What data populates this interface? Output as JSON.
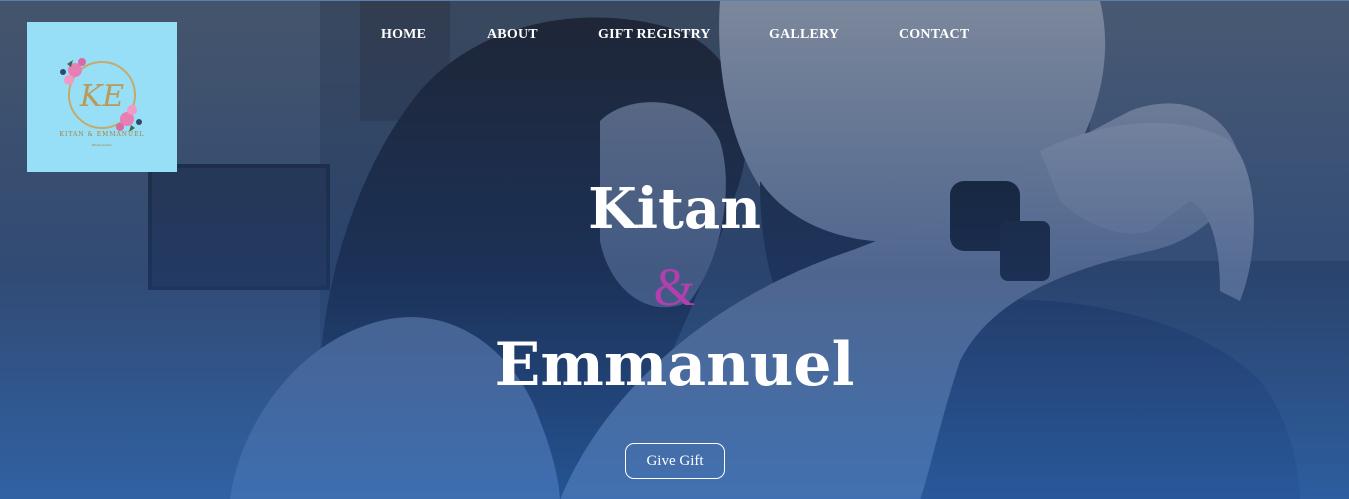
{
  "logo": {
    "monogram": "KE",
    "name": "KITAN & EMMANUEL",
    "subtitle": "#Kekeimbido"
  },
  "nav": {
    "items": [
      {
        "label": "HOME"
      },
      {
        "label": "ABOUT"
      },
      {
        "label": "GIFT REGISTRY"
      },
      {
        "label": "GALLERY"
      },
      {
        "label": "CONTACT"
      }
    ]
  },
  "hero": {
    "first_name": "Kitan",
    "ampersand": "&",
    "second_name": "Emmanuel",
    "cta_label": "Give Gift"
  },
  "colors": {
    "accent_ampersand": "#b23fae",
    "logo_background": "#97dff7",
    "overlay_blue": "#2a5aa0"
  }
}
